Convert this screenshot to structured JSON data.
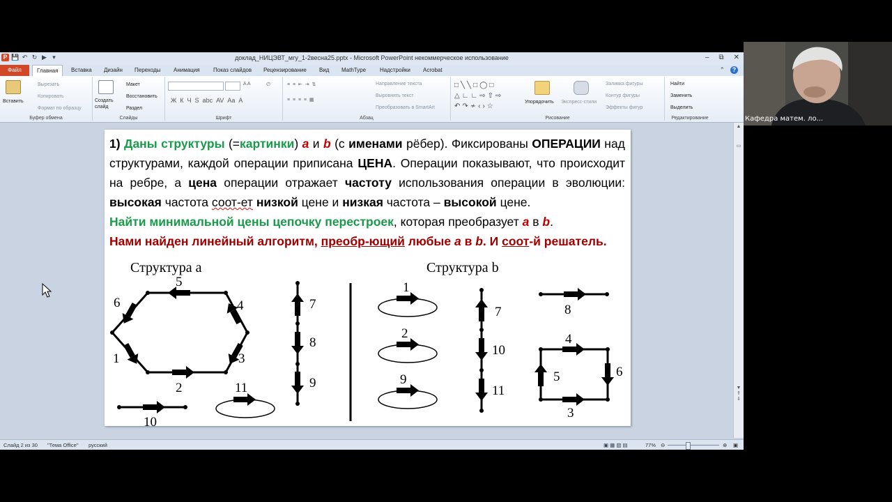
{
  "window": {
    "title": "доклад_НИЦЭВТ_мгу_1-2весна25.pptx - Microsoft PowerPoint некоммерческое использование"
  },
  "menu": {
    "file": "Файл",
    "tabs": [
      "Главная",
      "Вставка",
      "Дизайн",
      "Переходы",
      "Анимация",
      "Показ слайдов",
      "Рецензирование",
      "Вид",
      "MathType",
      "Надстройки",
      "Acrobat"
    ]
  },
  "ribbon": {
    "clipboard": {
      "paste": "Вставить",
      "cut": "Вырезать",
      "copy": "Копировать",
      "format": "Формат по образцу",
      "label": "Буфер обмена"
    },
    "slides": {
      "new": "Создать слайд",
      "layout": "Макет",
      "reset": "Восстановить",
      "section": "Раздел",
      "label": "Слайды"
    },
    "font": {
      "label": "Шрифт"
    },
    "paragraph": {
      "text_direction": "Направление текста",
      "align_text": "Выровнять текст",
      "smartart": "Преобразовать в SmartArt",
      "label": "Абзац"
    },
    "drawing": {
      "arrange": "Упорядочить",
      "quick_styles": "Экспресс-стили",
      "fill": "Заливка фигуры",
      "outline": "Контур фигуры",
      "effects": "Эффекты фигур",
      "label": "Рисование"
    },
    "editing": {
      "find": "Найти",
      "replace": "Заменить",
      "select": "Выделить",
      "label": "Редактирование"
    }
  },
  "slide": {
    "p1": "1)",
    "p2": "Даны структуры",
    "p3": "(=",
    "p4": "картинки",
    "p5": ")",
    "p6": "a",
    "p7": "и",
    "p8": "b",
    "p9": "(с",
    "p10": "именами",
    "p11": "рёбер). Фиксированы",
    "p12": "ОПЕРАЦИИ",
    "p13": "над структурами, каждой операции приписана",
    "p14": "ЦЕНА",
    "p15": ". Операции показывают, что происходит на ребре, а",
    "p16": "цена",
    "p17": "операции отражает",
    "p18": "частоту",
    "p19": "использования операции в эволюции:",
    "p20": "высокая",
    "p21": "частота",
    "p22": "соот-ет",
    "p23": "низкой",
    "p24": "цене и",
    "p25": "низкая",
    "p26": "частота –",
    "p27": "высокой",
    "p28": "цене.",
    "p29": "Найти минимальной цены цепочку перестроек",
    "p30": ", которая преобразует",
    "p31": "a",
    "p32": "в",
    "p33": "b",
    "p34": ".",
    "p35": "Нами найден линейный алгоритм,",
    "p36": "преобр-ющий",
    "p37": "любые",
    "p38": "a",
    "p39": "в",
    "p40": "b",
    "p41": ". И",
    "p42": "соот",
    "p43": "-й решатель.",
    "struct_a": "Структура a",
    "struct_b": "Структура b",
    "a_labels": [
      "5",
      "6",
      "4",
      "1",
      "3",
      "2",
      "7",
      "8",
      "9",
      "11",
      "10"
    ],
    "b_labels": [
      "1",
      "2",
      "9",
      "7",
      "10",
      "11",
      "8",
      "4",
      "5",
      "6",
      "3"
    ]
  },
  "statusbar": {
    "slide": "Слайд 2 из 30",
    "theme": "\"Тема Office\"",
    "lang": "русский",
    "zoom": "77%",
    "zoom_level": 0.77
  },
  "webcam": {
    "name": "Кафедра матем. ло..."
  }
}
